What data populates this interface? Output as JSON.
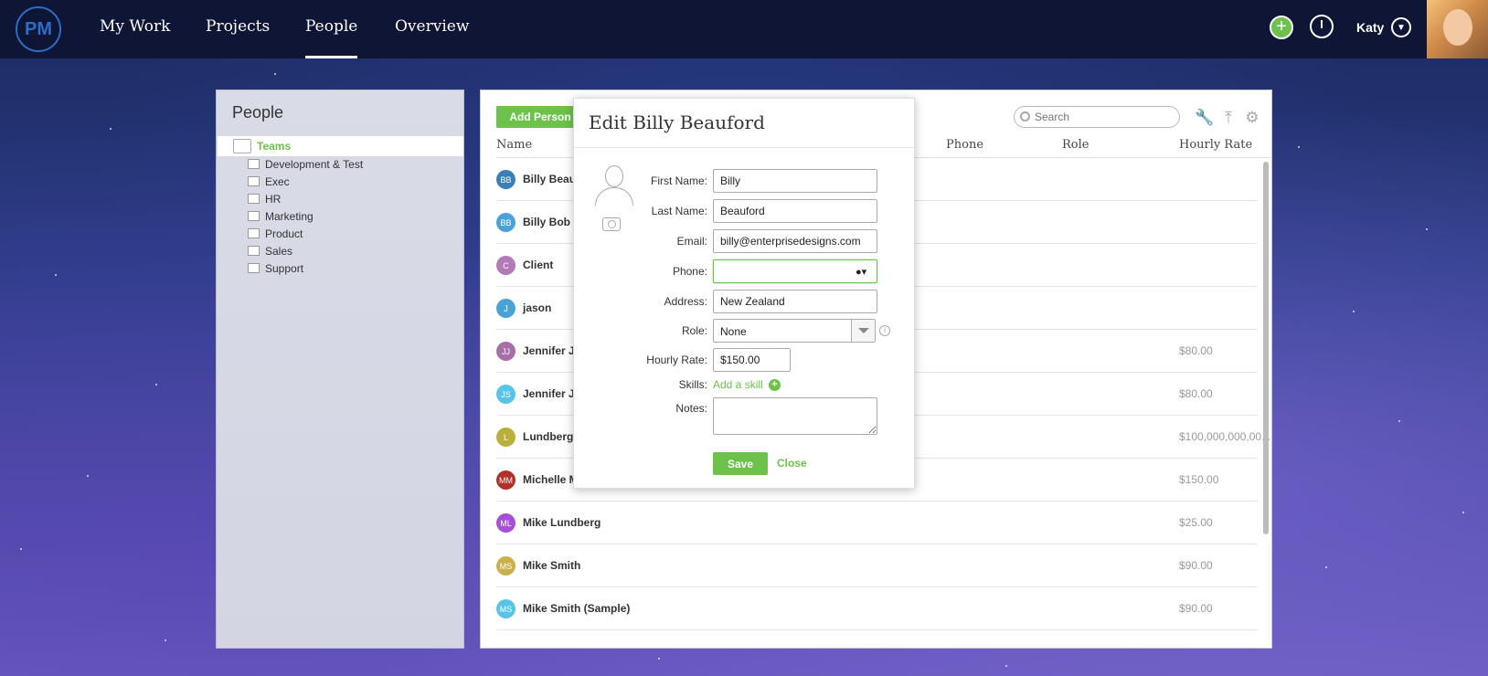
{
  "nav": {
    "logo": "PM",
    "items": [
      {
        "label": "My Work",
        "active": false
      },
      {
        "label": "Projects",
        "active": false
      },
      {
        "label": "People",
        "active": true
      },
      {
        "label": "Overview",
        "active": false
      }
    ],
    "user_name": "Katy"
  },
  "left_panel": {
    "title": "People",
    "root_label": "Teams",
    "teams": [
      "Development & Test",
      "Exec",
      "HR",
      "Marketing",
      "Product",
      "Sales",
      "Support"
    ]
  },
  "main": {
    "add_person_label": "Add Person",
    "search_placeholder": "Search",
    "columns": {
      "name": "Name",
      "phone": "Phone",
      "role": "Role",
      "hourly_rate": "Hourly Rate"
    },
    "rows": [
      {
        "initials": "BB",
        "name": "Billy Beau",
        "rate": "",
        "color": "#3a7fb5"
      },
      {
        "initials": "BB",
        "name": "Billy Bob",
        "rate": "",
        "color": "#4aa3d8"
      },
      {
        "initials": "C",
        "name": "Client",
        "rate": "",
        "color": "#b37bb5"
      },
      {
        "initials": "J",
        "name": "jason",
        "rate": "",
        "color": "#4aa3d8"
      },
      {
        "initials": "JJ",
        "name": "Jennifer J",
        "rate": "$80.00",
        "color": "#a66fa8"
      },
      {
        "initials": "JS",
        "name": "Jennifer J",
        "rate": "$80.00",
        "color": "#57c4e8"
      },
      {
        "initials": "L",
        "name": "Lundberg",
        "rate": "$100,000,000,00...",
        "color": "#b8b03a"
      },
      {
        "initials": "MM",
        "name": "Michelle M",
        "rate": "$150.00",
        "color": "#b0302a"
      },
      {
        "initials": "ML",
        "name": "Mike Lundberg",
        "rate": "$25.00",
        "color": "#a64fd8"
      },
      {
        "initials": "MS",
        "name": "Mike Smith",
        "rate": "$90.00",
        "color": "#c9b04a"
      },
      {
        "initials": "MS",
        "name": "Mike Smith (Sample)",
        "rate": "$90.00",
        "color": "#57c4e8"
      }
    ]
  },
  "modal": {
    "title": "Edit Billy Beauford",
    "labels": {
      "first_name": "First Name:",
      "last_name": "Last Name:",
      "email": "Email:",
      "phone": "Phone:",
      "address": "Address:",
      "role": "Role:",
      "hourly_rate": "Hourly Rate:",
      "skills": "Skills:",
      "notes": "Notes:"
    },
    "values": {
      "first_name": "Billy",
      "last_name": "Beauford",
      "email": "billy@enterprisedesigns.com",
      "phone": "",
      "address": "New Zealand",
      "role": "None",
      "hourly_rate": "$150.00",
      "notes": ""
    },
    "add_skill_label": "Add a skill",
    "save_label": "Save",
    "close_label": "Close"
  },
  "colors": {
    "accent": "#6cc24a",
    "nav_bg": "#0f1535"
  }
}
